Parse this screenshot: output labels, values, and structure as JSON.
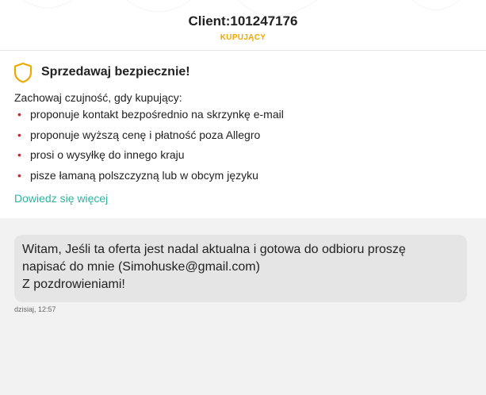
{
  "header": {
    "title": "Client:101247176",
    "subtitle": "KUPUJĄCY"
  },
  "warning": {
    "icon": "shield-icon",
    "title": "Sprzedawaj bezpiecznie!",
    "intro": "Zachowaj czujność, gdy kupujący:",
    "items": [
      "proponuje kontakt bezpośrednio na skrzynkę e-mail",
      "proponuje wyższą cenę i płatność poza Allegro",
      "prosi o wysyłkę do innego kraju",
      "pisze łamaną polszczyzną lub w obcym języku"
    ],
    "bullet": "•",
    "link": "Dowiedz się więcej",
    "accent_color": "#f0a800",
    "link_color": "#2bb3a0",
    "bullet_color": "#d8232a"
  },
  "message": {
    "lines": [
      "Witam, Jeśli ta oferta jest nadal aktualna i gotowa do odbioru proszę",
      "napisać do mnie (Simohuske@gmail.com)",
      "Z pozdrowieniami!"
    ],
    "timestamp": "dzisiaj, 12:57"
  }
}
